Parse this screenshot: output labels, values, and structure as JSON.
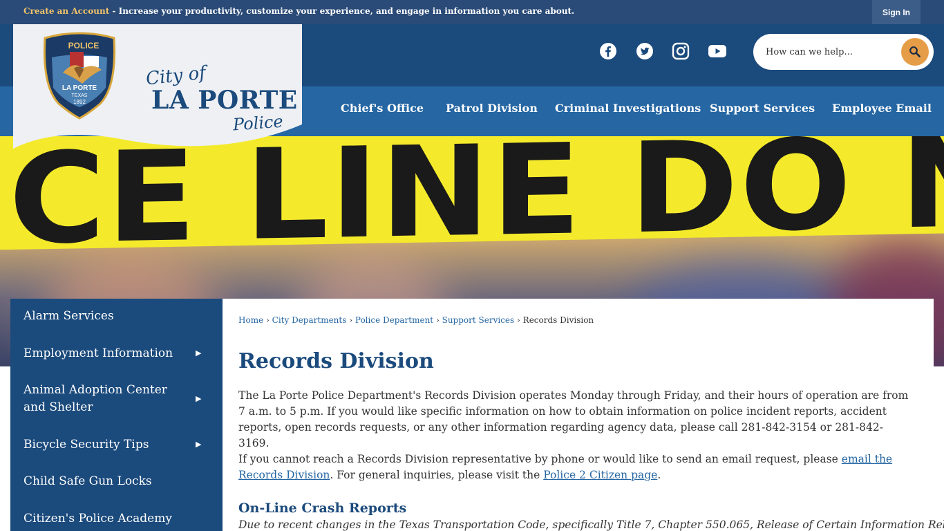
{
  "topbar": {
    "create_account": "Create an Account",
    "message": " - Increase your productivity, customize your experience, and engage in information you care about.",
    "sign_in": "Sign In"
  },
  "logo": {
    "badge_top": "POLICE",
    "badge_city": "LA PORTE",
    "badge_state": "TEXAS",
    "badge_year": "1892",
    "city_of": "City of",
    "name": "LA PORTE",
    "sub": "Police"
  },
  "social": {
    "icons": [
      "facebook-icon",
      "twitter-icon",
      "instagram-icon",
      "youtube-icon"
    ]
  },
  "search": {
    "placeholder": "How can we help..."
  },
  "nav": {
    "items": [
      "Chief's Office",
      "Patrol Division",
      "Criminal Investigations",
      "Support Services",
      "Employee Email"
    ]
  },
  "hero": {
    "tape_text": "ICE LINE DO NOT CR"
  },
  "sidebar": {
    "items": [
      {
        "label": "Alarm Services",
        "has_children": false
      },
      {
        "label": "Employment Information",
        "has_children": true
      },
      {
        "label": "Animal Adoption Center and Shelter",
        "has_children": true
      },
      {
        "label": "Bicycle Security Tips",
        "has_children": true
      },
      {
        "label": "Child Safe Gun Locks",
        "has_children": false
      },
      {
        "label": "Citizen's Police Academy",
        "has_children": false
      }
    ]
  },
  "breadcrumb": {
    "home": "Home",
    "city_departments": "City Departments",
    "police_department": "Police Department",
    "support_services": "Support Services",
    "current": "Records Division",
    "separator": "›"
  },
  "content": {
    "title": "Records Division",
    "para1": "The La Porte Police Department's Records Division operates Monday through Friday, and their hours of operation are from 7 a.m. to 5 p.m. If you would like specific information on how to obtain information on police incident reports, accident reports, open records requests, or any other information regarding agency data, please call 281-842-3154 or 281-842-3169.",
    "para2_pre": "If you cannot reach a Records Division representative by phone or would like to send an email request, please ",
    "para2_link1": "email the Records Division",
    "para2_mid": ". For general inquiries, please visit the ",
    "para2_link2": "Police 2 Citizen page",
    "para2_post": ".",
    "section_title": "On-Line Crash Reports",
    "section_text": "Due to recent changes in the Texas Transportation Code, specifically Title 7, Chapter 550.065, Release of Certain Information Relating to"
  },
  "colors": {
    "topbar": "#2a4a77",
    "header": "#1b4a7c",
    "nav": "#2566a3",
    "accent": "#e69d48",
    "create_account": "#f1c36a"
  }
}
